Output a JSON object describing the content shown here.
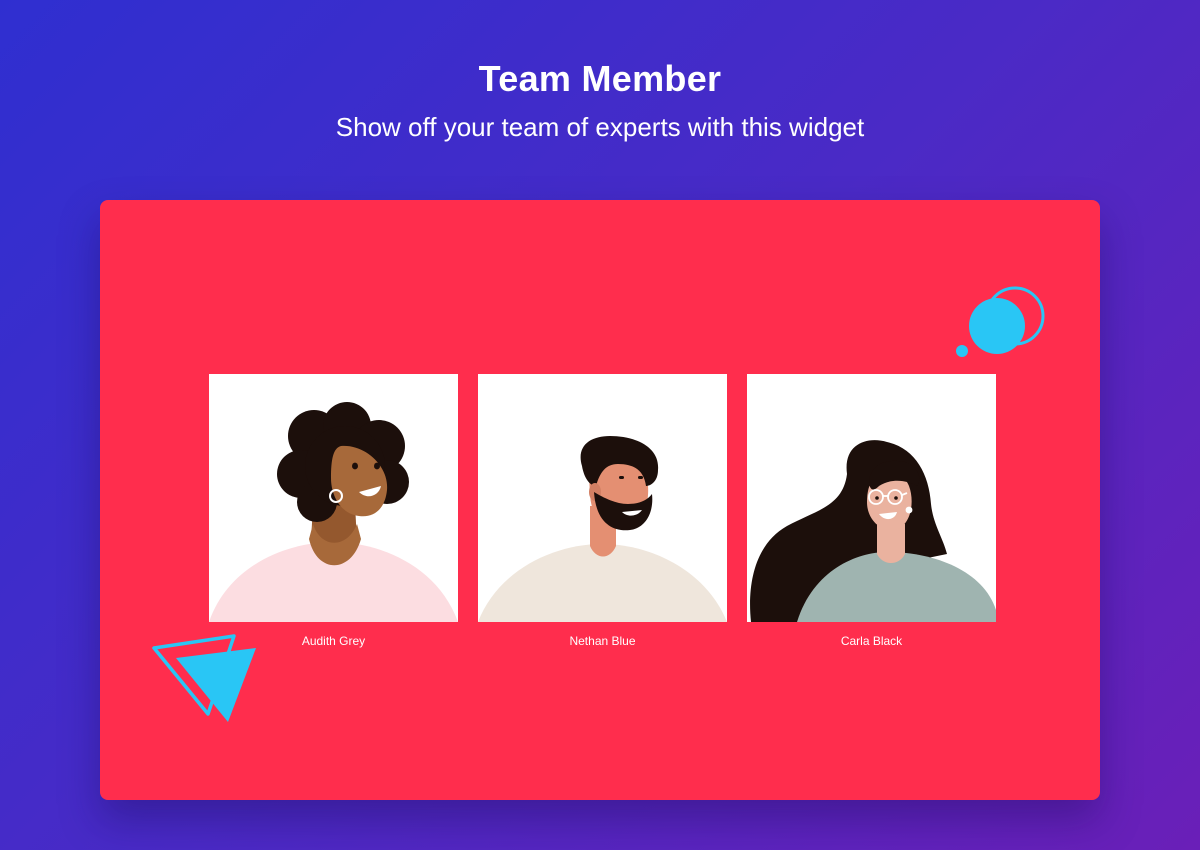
{
  "header": {
    "title": "Team Member",
    "subtitle": "Show off your team of experts with this widget"
  },
  "team": [
    {
      "name": "Audith Grey",
      "icon": "woman-curly-hair-portrait",
      "shirt_color": "#fcdde1"
    },
    {
      "name": "Nethan Blue",
      "icon": "bearded-man-portrait",
      "shirt_color": "#efe6dc"
    },
    {
      "name": "Carla Black",
      "icon": "woman-long-hair-glasses-portrait",
      "shirt_color": "#9fb4b0"
    }
  ],
  "colors": {
    "background_start": "#2f2fd0",
    "background_end": "#6a1fb8",
    "panel": "#ff2d4d",
    "accent": "#29c6f5",
    "card": "#ffffff"
  }
}
